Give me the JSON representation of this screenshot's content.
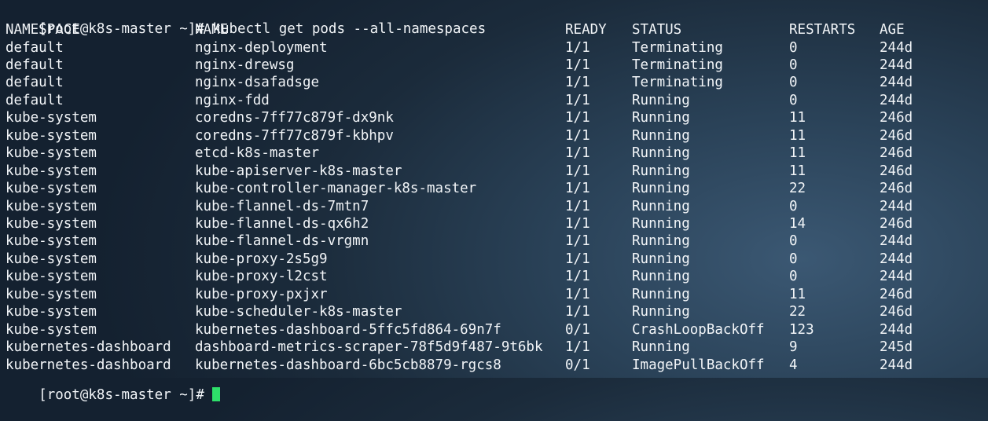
{
  "terminal": {
    "prompt": "[root@k8s-master ~]# ",
    "command": "kubectl get pods --all-namespaces",
    "bottom_prompt": "[root@k8s-master ~]# "
  },
  "table": {
    "headers": {
      "namespace": "NAMESPACE",
      "name": "NAME",
      "ready": "READY",
      "status": "STATUS",
      "restarts": "RESTARTS",
      "age": "AGE"
    },
    "rows": [
      {
        "namespace": "default",
        "name": "nginx-deployment",
        "ready": "1/1",
        "status": "Terminating",
        "restarts": "0",
        "age": "244d"
      },
      {
        "namespace": "default",
        "name": "nginx-drewsg",
        "ready": "1/1",
        "status": "Terminating",
        "restarts": "0",
        "age": "244d"
      },
      {
        "namespace": "default",
        "name": "nginx-dsafadsge",
        "ready": "1/1",
        "status": "Terminating",
        "restarts": "0",
        "age": "244d"
      },
      {
        "namespace": "default",
        "name": "nginx-fdd",
        "ready": "1/1",
        "status": "Running",
        "restarts": "0",
        "age": "244d"
      },
      {
        "namespace": "kube-system",
        "name": "coredns-7ff77c879f-dx9nk",
        "ready": "1/1",
        "status": "Running",
        "restarts": "11",
        "age": "246d"
      },
      {
        "namespace": "kube-system",
        "name": "coredns-7ff77c879f-kbhpv",
        "ready": "1/1",
        "status": "Running",
        "restarts": "11",
        "age": "246d"
      },
      {
        "namespace": "kube-system",
        "name": "etcd-k8s-master",
        "ready": "1/1",
        "status": "Running",
        "restarts": "11",
        "age": "246d"
      },
      {
        "namespace": "kube-system",
        "name": "kube-apiserver-k8s-master",
        "ready": "1/1",
        "status": "Running",
        "restarts": "11",
        "age": "246d"
      },
      {
        "namespace": "kube-system",
        "name": "kube-controller-manager-k8s-master",
        "ready": "1/1",
        "status": "Running",
        "restarts": "22",
        "age": "246d"
      },
      {
        "namespace": "kube-system",
        "name": "kube-flannel-ds-7mtn7",
        "ready": "1/1",
        "status": "Running",
        "restarts": "0",
        "age": "244d"
      },
      {
        "namespace": "kube-system",
        "name": "kube-flannel-ds-qx6h2",
        "ready": "1/1",
        "status": "Running",
        "restarts": "14",
        "age": "246d"
      },
      {
        "namespace": "kube-system",
        "name": "kube-flannel-ds-vrgmn",
        "ready": "1/1",
        "status": "Running",
        "restarts": "0",
        "age": "244d"
      },
      {
        "namespace": "kube-system",
        "name": "kube-proxy-2s5g9",
        "ready": "1/1",
        "status": "Running",
        "restarts": "0",
        "age": "244d"
      },
      {
        "namespace": "kube-system",
        "name": "kube-proxy-l2cst",
        "ready": "1/1",
        "status": "Running",
        "restarts": "0",
        "age": "244d"
      },
      {
        "namespace": "kube-system",
        "name": "kube-proxy-pxjxr",
        "ready": "1/1",
        "status": "Running",
        "restarts": "11",
        "age": "246d"
      },
      {
        "namespace": "kube-system",
        "name": "kube-scheduler-k8s-master",
        "ready": "1/1",
        "status": "Running",
        "restarts": "22",
        "age": "246d"
      },
      {
        "namespace": "kube-system",
        "name": "kubernetes-dashboard-5ffc5fd864-69n7f",
        "ready": "0/1",
        "status": "CrashLoopBackOff",
        "restarts": "123",
        "age": "244d"
      },
      {
        "namespace": "kubernetes-dashboard",
        "name": "dashboard-metrics-scraper-78f5d9f487-9t6bk",
        "ready": "1/1",
        "status": "Running",
        "restarts": "9",
        "age": "245d"
      },
      {
        "namespace": "kubernetes-dashboard",
        "name": "kubernetes-dashboard-6bc5cb8879-rgcs8",
        "ready": "0/1",
        "status": "ImagePullBackOff",
        "restarts": "4",
        "age": "244d"
      }
    ]
  },
  "colors": {
    "text": "#f2f5f8",
    "cursor": "#2ee06a",
    "background": "#1f3346"
  }
}
